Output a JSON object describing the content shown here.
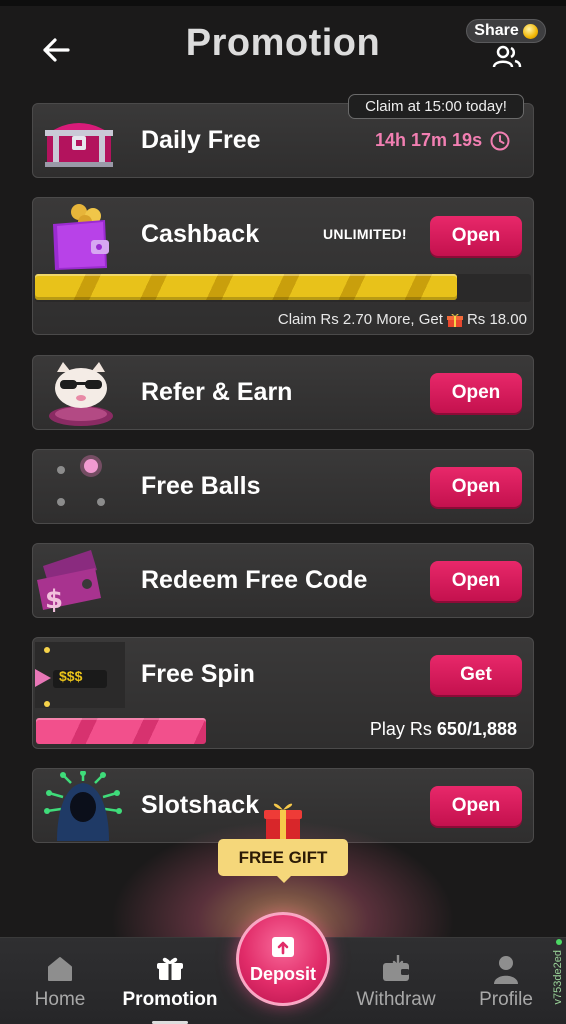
{
  "header": {
    "title": "Promotion",
    "share_label": "Share",
    "back_icon": "arrow-left-icon",
    "users_icon": "users-icon"
  },
  "cards": {
    "daily_free": {
      "title": "Daily Free",
      "claim_tag": "Claim at 15:00 today!",
      "timer": "14h 17m 19s"
    },
    "cashback": {
      "title": "Cashback",
      "badge": "UNLIMITED!",
      "button": "Open",
      "progress": 0.85,
      "claim_text_prefix": "Claim Rs 2.70 More, Get",
      "claim_text_suffix": "Rs 18.00"
    },
    "refer": {
      "title": "Refer & Earn",
      "button": "Open"
    },
    "free_balls": {
      "title": "Free Balls",
      "button": "Open"
    },
    "redeem": {
      "title": "Redeem Free Code",
      "button": "Open"
    },
    "free_spin": {
      "title": "Free Spin",
      "button": "Get",
      "icon_text": "$$$",
      "progress": 0.344,
      "play_prefix": "Play Rs",
      "play_value": "650/1,888"
    },
    "slotshack": {
      "title": "Slotshack",
      "button": "Open"
    }
  },
  "free_gift": {
    "label": "FREE GIFT"
  },
  "bottom_nav": {
    "home": "Home",
    "promotion": "Promotion",
    "deposit": "Deposit",
    "withdraw": "Withdraw",
    "profile": "Profile",
    "active": "promotion"
  },
  "version": "v753de2ed",
  "colors": {
    "accent_pink": "#e12c69",
    "timer_pink": "#f27fb2",
    "gold": "#e8c21a",
    "gift_yellow": "#f5d77a"
  }
}
